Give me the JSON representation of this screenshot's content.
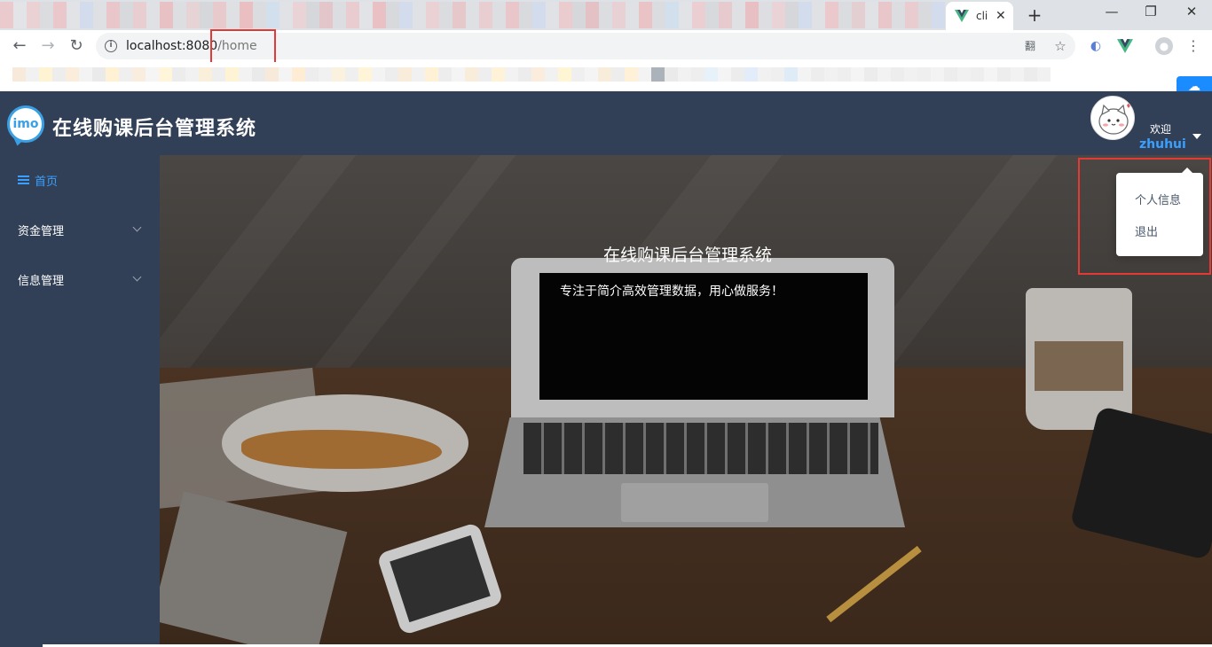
{
  "browser": {
    "tab_title": "cli",
    "tab_close": "✕",
    "new_tab": "+",
    "win_minimize": "—",
    "win_restore": "❐",
    "win_close": "✕",
    "nav_back": "←",
    "nav_forward": "→",
    "nav_reload": "↻",
    "url_host": "localhost:8080",
    "url_path": "/home",
    "translate_icon": "翻",
    "star_icon": "☆",
    "cloud_icon": "☁",
    "blur_colors": [
      "#f4b8b8",
      "#e8e8e8",
      "#f4c4c4",
      "#d8d8d8",
      "#f2b3b3",
      "#e6e6e6",
      "#c8d8f0",
      "#e0e0e0",
      "#f0b0b0",
      "#d4d4d4",
      "#f2c0c0",
      "#e2e2e2",
      "#f0a8a8",
      "#dcdcdc",
      "#ecc8c8",
      "#d0d0d0",
      "#f0b8b8",
      "#e0e0e0",
      "#f2a4a4",
      "#d8d8d8",
      "#c8e0f4",
      "#e4e4e4",
      "#f4c8c8",
      "#d0d0d0",
      "#e8b0b0",
      "#dadada",
      "#f0bcbc",
      "#e6e6e6",
      "#f2a8a8",
      "#d4d4d4",
      "#c8d8f0",
      "#e2e2e2",
      "#f4c4c4",
      "#d8d8d8",
      "#ecb4b4",
      "#e0e0e0",
      "#f0c0c0",
      "#dcdcdc",
      "#f2b0b0",
      "#d6d6d6",
      "#c8d8f0",
      "#e4e4e4",
      "#f4bcbc",
      "#d0d0d0",
      "#e8a8a8",
      "#dadada",
      "#f0c4c4",
      "#e2e2e2",
      "#f2acac",
      "#d8d8d8",
      "#c8e0f4",
      "#e6e6e6",
      "#f4c0c0",
      "#d4d4d4",
      "#ecb8b8",
      "#e0e0e0",
      "#f0a4a4",
      "#dcdcdc",
      "#f2c8c8",
      "#d0d0d0",
      "#c8d8f0",
      "#e2e2e2",
      "#f4b4b4",
      "#d8d8d8",
      "#e8c0c0",
      "#e4e4e4",
      "#f0b0b0",
      "#dadada",
      "#f2bcbc",
      "#d6d6d6",
      "#c8d8f0"
    ],
    "bm_colors": [
      "#f0d0b0",
      "#e0e0e0",
      "#fde6a0",
      "#d8d8d8",
      "#f6d8b0",
      "#e4e4e4",
      "#d0d0d0",
      "#fde0a0",
      "#dcdcdc",
      "#f0d8b8",
      "#e8e8e8",
      "#fde8b0",
      "#d4d4d4",
      "#e0e0e0",
      "#f4dcb0",
      "#dadada",
      "#fde4a0",
      "#e2e2e2",
      "#d0d0d0",
      "#f0d0b0",
      "#e6e6e6",
      "#fdd8a0",
      "#d8d8d8",
      "#e0e0e0",
      "#f6e0b8",
      "#dcdcdc",
      "#fde6a8",
      "#e4e4e4",
      "#d6d6d6",
      "#f2d4b0",
      "#e0e0e0",
      "#fde0a4",
      "#d8d8d8",
      "#e6e6e6",
      "#f0d8b0",
      "#dadada",
      "#fde4a8",
      "#e2e2e2",
      "#d4d4d4",
      "#f4d8b4",
      "#e0e0e0",
      "#fde8a0",
      "#dcdcdc",
      "#e6e6e6",
      "#f0d4b0",
      "#d8d8d8",
      "#fde0a8",
      "#e4e4e4",
      "#445566",
      "#d0d0d0",
      "#e0e0e0",
      "#dadada",
      "#c8e0f4",
      "#e6e6e6",
      "#d4d4d4",
      "#c0d8f4",
      "#e0e0e0",
      "#dcdcdc",
      "#b8d4f0",
      "#e4e4e4",
      "#d8d8d8",
      "#e0e0e0",
      "#dadada",
      "#e6e6e6",
      "#d4d4d4",
      "#e2e2e2",
      "#d8d8d8",
      "#e0e0e0",
      "#dcdcdc",
      "#e4e4e4",
      "#d6d6d6",
      "#e0e0e0",
      "#dadada",
      "#e6e6e6",
      "#d8d8d8",
      "#e2e2e2",
      "#d4d4d4",
      "#e0e0e0"
    ]
  },
  "header": {
    "logo_text": "imo",
    "title": "在线购课后台管理系统",
    "welcome": "欢迎",
    "username": "zhuhui"
  },
  "sidebar": {
    "items": [
      {
        "label": "首页",
        "active": true
      },
      {
        "label": "资金管理",
        "active": false
      },
      {
        "label": "信息管理",
        "active": false
      }
    ]
  },
  "main": {
    "hero_title": "在线购课后台管理系统",
    "hero_subtitle": "专注于简介高效管理数据，用心做服务！"
  },
  "dropdown": {
    "items": [
      "个人信息",
      "退出"
    ]
  },
  "colors": {
    "header_bg": "#324057",
    "accent": "#3aa0ff",
    "highlight_border": "#e53935"
  }
}
